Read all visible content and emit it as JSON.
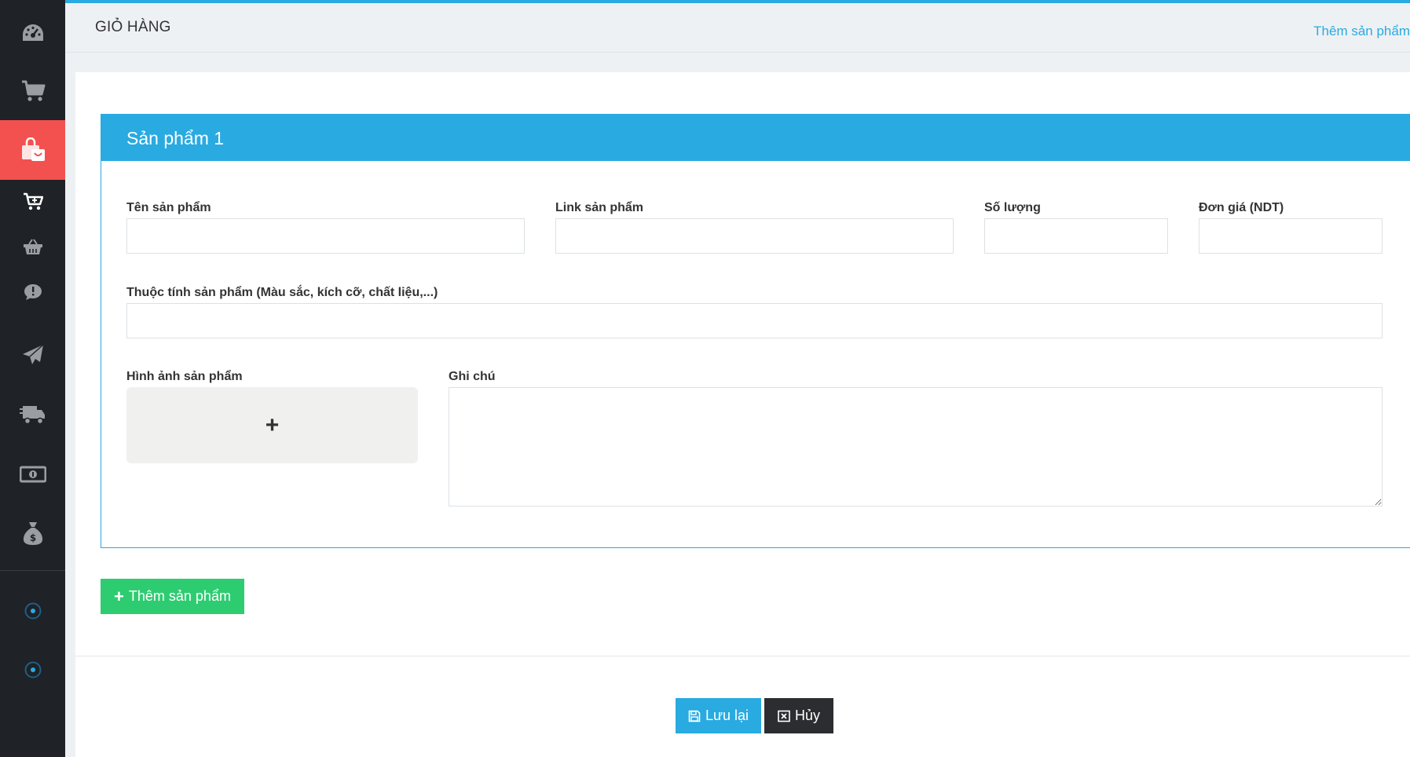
{
  "header": {
    "title": "GIỎ HÀNG",
    "add_link": "Thêm sản phẩm"
  },
  "sidebar": {
    "items": [
      {
        "icon": "dashboard-icon"
      },
      {
        "icon": "cart-icon"
      },
      {
        "icon": "shopping-bag-icon",
        "active": true
      },
      {
        "icon": "cart-plus-icon"
      },
      {
        "icon": "basket-icon"
      },
      {
        "icon": "comment-alert-icon"
      },
      {
        "icon": "paper-plane-icon"
      },
      {
        "icon": "truck-icon"
      },
      {
        "icon": "money-icon"
      },
      {
        "icon": "money-bag-icon"
      },
      {
        "icon": "circle-dot-icon"
      },
      {
        "icon": "circle-dot-icon"
      }
    ]
  },
  "product_panel": {
    "title": "Sản phẩm 1",
    "fields": {
      "name_label": "Tên sản phẩm",
      "name_value": "",
      "link_label": "Link sản phẩm",
      "link_value": "",
      "quantity_label": "Số lượng",
      "quantity_value": "",
      "price_label": "Đơn giá (NDT)",
      "price_value": "",
      "attributes_label": "Thuộc tính sản phẩm (Màu sắc, kích cỡ, chất liệu,...)",
      "attributes_value": "",
      "image_label": "Hình ảnh sản phẩm",
      "note_label": "Ghi chú",
      "note_value": ""
    }
  },
  "actions": {
    "add_product": "Thêm sản phẩm",
    "save": "Lưu lại",
    "cancel": "Hủy"
  },
  "colors": {
    "accent": "#29aae1",
    "active_sidebar": "#f3514f",
    "sidebar_bg": "#1f2226",
    "add_button": "#2ecc71",
    "cancel_button": "#2b2d30"
  }
}
